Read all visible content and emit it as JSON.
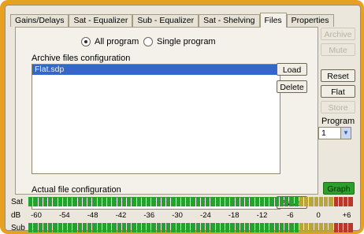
{
  "tabs": [
    {
      "label": "Gains/Delays",
      "active": false
    },
    {
      "label": "Sat - Equalizer",
      "active": false
    },
    {
      "label": "Sub - Equalizer",
      "active": false
    },
    {
      "label": "Sat - Shelving",
      "active": false
    },
    {
      "label": "Files",
      "active": true
    },
    {
      "label": "Properties",
      "active": false
    }
  ],
  "files": {
    "mode_all": "All program",
    "mode_single": "Single program",
    "selected_mode": "All program",
    "archive_label": "Archive files configuration",
    "archive_items": [
      "Flat.sdp"
    ],
    "load_button": "Load",
    "delete_button": "Delete",
    "actual_label": "Actual file configuration",
    "actual_value": "",
    "save_button": "Save"
  },
  "side": {
    "archive_button": "Archive",
    "mute_button": "Mute",
    "reset_button": "Reset",
    "flat_button": "Flat",
    "store_button": "Store",
    "program_label": "Program",
    "program_value": "1",
    "graph_button": "Graph"
  },
  "meters": {
    "sat_label": "Sat",
    "sub_label": "Sub",
    "scale_unit": "dB",
    "scale_ticks": [
      "-60",
      "-54",
      "-48",
      "-42",
      "-36",
      "-30",
      "-24",
      "-18",
      "-12",
      "-6",
      "0",
      "+6"
    ]
  },
  "colors": {
    "frame": "#e8a020",
    "meter_green": "#27a12e",
    "meter_yellow": "#b9a63a",
    "meter_red": "#b8382e",
    "selection": "#3567c9",
    "graph_button": "#2aa02a"
  }
}
